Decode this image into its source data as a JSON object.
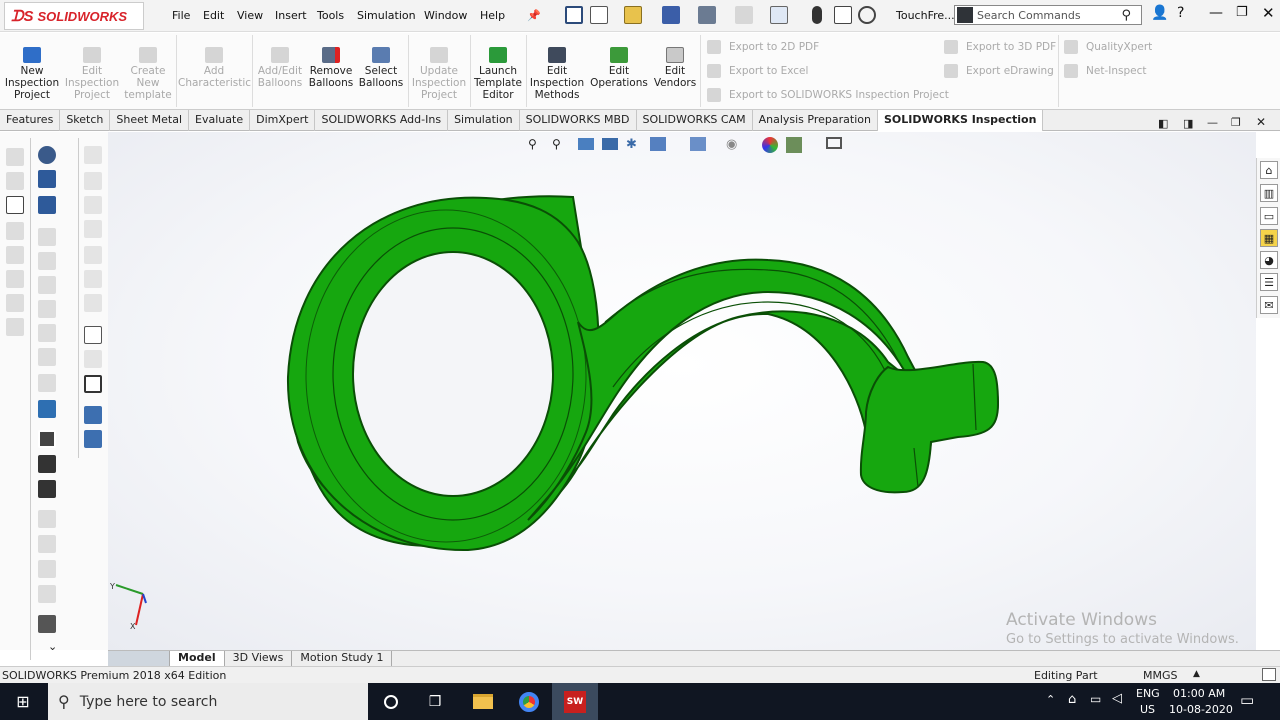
{
  "app": {
    "brand": "SOLIDWORKS",
    "edition": "SOLIDWORKS Premium 2018 x64 Edition"
  },
  "menu": [
    "File",
    "Edit",
    "View",
    "Insert",
    "Tools",
    "Simulation",
    "Window",
    "Help"
  ],
  "toolbar": {
    "file_label": "TouchFre..."
  },
  "search": {
    "placeholder": "Search Commands"
  },
  "commands": [
    {
      "label": "New Inspection Project",
      "lines": [
        "New",
        "Inspection",
        "Project"
      ],
      "enabled": true
    },
    {
      "label": "Edit Inspection Project",
      "lines": [
        "Edit",
        "Inspection",
        "Project"
      ],
      "enabled": false
    },
    {
      "label": "Create New template",
      "lines": [
        "Create",
        "New",
        "template"
      ],
      "enabled": false
    },
    {
      "label": "Add Characteristic",
      "lines": [
        "Add",
        "Characteristic"
      ],
      "enabled": false
    },
    {
      "label": "Add/Edit Balloons",
      "lines": [
        "Add/Edit",
        "Balloons"
      ],
      "enabled": false
    },
    {
      "label": "Remove Balloons",
      "lines": [
        "Remove",
        "Balloons"
      ],
      "enabled": true
    },
    {
      "label": "Select Balloons",
      "lines": [
        "Select",
        "Balloons"
      ],
      "enabled": true
    },
    {
      "label": "Update Inspection Project",
      "lines": [
        "Update",
        "Inspection",
        "Project"
      ],
      "enabled": false
    },
    {
      "label": "Launch Template Editor",
      "lines": [
        "Launch",
        "Template",
        "Editor"
      ],
      "enabled": true
    },
    {
      "label": "Edit Inspection Methods",
      "lines": [
        "Edit",
        "Inspection",
        "Methods"
      ],
      "enabled": true
    },
    {
      "label": "Edit Operations",
      "lines": [
        "Edit",
        "Operations"
      ],
      "enabled": true
    },
    {
      "label": "Edit Vendors",
      "lines": [
        "Edit",
        "Vendors"
      ],
      "enabled": true
    }
  ],
  "exports": [
    "Export to 2D PDF",
    "Export to Excel",
    "Export to SOLIDWORKS Inspection Project",
    "Export to 3D PDF",
    "Export eDrawing"
  ],
  "extras": [
    "QualityXpert",
    "Net-Inspect"
  ],
  "tabs": [
    "Features",
    "Sketch",
    "Sheet Metal",
    "Evaluate",
    "DimXpert",
    "SOLIDWORKS Add-Ins",
    "Simulation",
    "SOLIDWORKS MBD",
    "SOLIDWORKS CAM",
    "Analysis Preparation",
    "SOLIDWORKS Inspection"
  ],
  "active_tab": "SOLIDWORKS Inspection",
  "bottom_tabs": [
    "Model",
    "3D Views",
    "Motion Study 1"
  ],
  "status": {
    "editing": "Editing Part",
    "units": "MMGS"
  },
  "watermark": {
    "title": "Activate Windows",
    "subtitle": "Go to Settings to activate Windows."
  },
  "taskbar": {
    "search": "Type here to search",
    "lang": "ENG",
    "region": "US",
    "time": "01:00 AM",
    "date": "10-08-2020"
  },
  "colors": {
    "part": "#16a70f",
    "part_edge": "#0a4f06",
    "brand_red": "#d8232a"
  }
}
